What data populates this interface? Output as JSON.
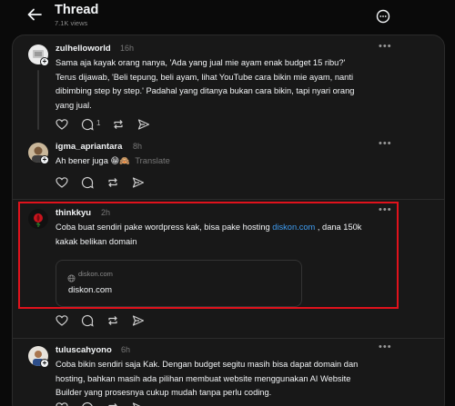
{
  "header": {
    "title": "Thread",
    "views": "7.1K views"
  },
  "posts": [
    {
      "username": "zulhelloworld",
      "time": "16h",
      "lines": [
        "Sama aja kayak orang nanya, 'Ada yang jual mie ayam enak budget 15 ribu?'",
        "Terus dijawab, 'Beli tepung, beli ayam, lihat YouTube cara bikin mie ayam, nanti",
        "dibimbing step by step.' Padahal yang ditanya bukan cara bikin, tapi nyari orang",
        "yang jual."
      ],
      "reply_count": "1"
    },
    {
      "username": "igma_apriantara",
      "time": "8h",
      "text": "Ah bener juga 😁🙈",
      "translate": "Translate"
    },
    {
      "username": "thinkkyu",
      "time": "2h",
      "line1_before": "Coba buat sendiri pake wordpress kak, bisa pake hosting ",
      "link": "diskon.com",
      "line1_after": " , dana 150k",
      "line2": "kakak belikan domain",
      "card_domain": "diskon.com",
      "card_title": "diskon.com"
    },
    {
      "username": "tuluscahyono",
      "time": "6h",
      "lines": [
        "Coba bikin sendiri saja Kak. Dengan budget segitu masih bisa dapat domain dan",
        "hosting, bahkan masih ada pilihan membuat website menggunakan AI Website",
        "Builder yang prosesnya cukup mudah tanpa perlu coding."
      ]
    }
  ],
  "colors": {
    "background": "#0a0a0a",
    "panel": "#181818",
    "link": "#3f9cf0",
    "highlight": "#e0121c"
  }
}
